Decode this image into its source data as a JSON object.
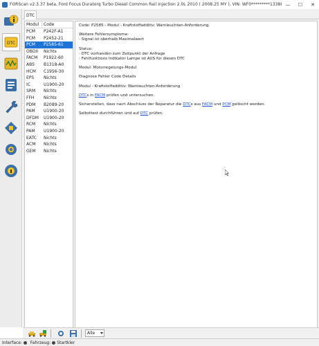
{
  "window": {
    "title": "FORScan v2.3.37 beta, Ford Focus Duratorq Turbo Diesel Common Rail Injection 2.0L 2010 ( 2008.25 MY ), VIN: WF0*********13388",
    "minimize": "—",
    "maximize": "☐",
    "close": "✕"
  },
  "sidebar": {
    "items": [
      {
        "name": "info",
        "icon": "info-icon"
      },
      {
        "name": "dtc",
        "icon": "dtc-icon",
        "active": true
      },
      {
        "name": "oscilloscope",
        "icon": "oscilloscope-icon"
      },
      {
        "name": "checklist",
        "icon": "checklist-icon"
      },
      {
        "name": "service",
        "icon": "wrench-icon"
      },
      {
        "name": "config",
        "icon": "config-icon"
      },
      {
        "name": "settings",
        "icon": "gear-icon"
      },
      {
        "name": "help",
        "icon": "help-icon"
      }
    ]
  },
  "tabs": {
    "dtc": "DTC"
  },
  "list": {
    "headers": {
      "module": "Modul",
      "code": "Code"
    },
    "rows": [
      {
        "module": "PCM",
        "code": "P242F-A1"
      },
      {
        "module": "PCM",
        "code": "P2452-21"
      },
      {
        "module": "PCM",
        "code": "P2585-61",
        "selected": true
      },
      {
        "module": "OBDII",
        "code": "Nichts"
      },
      {
        "module": "FACM",
        "code": "P1922-60"
      },
      {
        "module": "ABS",
        "code": "B1318-A0"
      },
      {
        "module": "HCM",
        "code": "C1956-30"
      },
      {
        "module": "EPS",
        "code": "Nichts"
      },
      {
        "module": "IC",
        "code": "U1900-20"
      },
      {
        "module": "SRM",
        "code": "Nichts"
      },
      {
        "module": "FFH",
        "code": "Nichts"
      },
      {
        "module": "PDM",
        "code": "B2089-20"
      },
      {
        "module": "PAM",
        "code": "U1900-20"
      },
      {
        "module": "DFDM",
        "code": "U1900-20"
      },
      {
        "module": "RCM",
        "code": "Nichts"
      },
      {
        "module": "PAM",
        "code": "U1900-20"
      },
      {
        "module": "EATC",
        "code": "Nichts"
      },
      {
        "module": "ACM",
        "code": "Nichts"
      },
      {
        "module": "GEM",
        "code": "Nichts"
      }
    ]
  },
  "detail": {
    "line1": "Code: P2585 - Modul - Kraftstoffadditiv: Warnleuchten-Anforderung",
    "line2": "Weitere Fehlersymptome:",
    "line3": " - Signal ist oberhalb Maximalwert",
    "line4": "Status:",
    "line5": " - DTC vorhanden zum Zeitpunkt der Anfrage",
    "line6": " - Fehlfunktions Indikator Lampe ist AUS für diesen DTC",
    "line7": "Modul: Motorregelungs-Modul",
    "line8": "Diagnose Fehler Code Details",
    "line9": "Modul - Kraftstoffadditiv: Warnleuchten-Anforderung",
    "line10": {
      "a": "DTC",
      "b": "s in ",
      "c": "FACM",
      "d": " prüfen und untersuchen."
    },
    "line11": {
      "a": "Sicherstellen, dass nach Abschluss der Reparatur die ",
      "b": "DTC",
      "c": "s aus ",
      "d": "FACM",
      "e": " und ",
      "f": "PCM",
      "g": " gelöscht werden."
    },
    "line12": {
      "a": "Selbsttest durchführen und auf ",
      "b": "DTC",
      "c": " prüfen."
    }
  },
  "toolbar": {
    "filter_value": "Alle",
    "buttons": [
      "car-read-icon",
      "car-clear-icon",
      "refresh-icon",
      "save-icon"
    ]
  },
  "status": {
    "interface_label": "Interface:",
    "vehicle_label": "Fahrzeug:",
    "starter_label": "Startkler"
  }
}
